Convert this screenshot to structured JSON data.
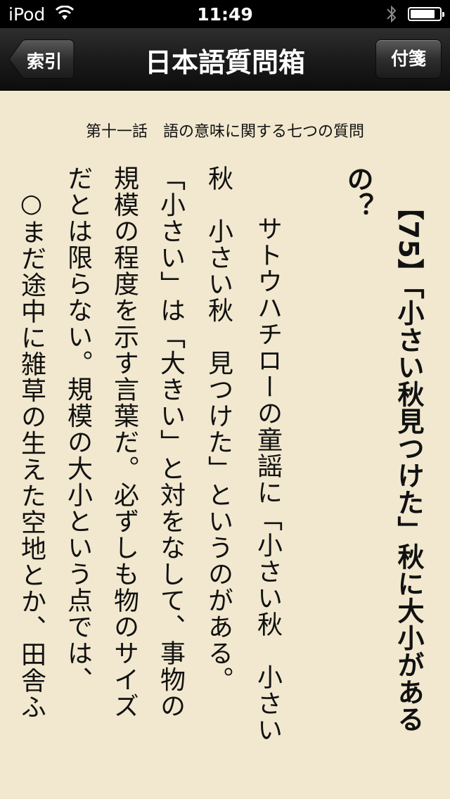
{
  "status": {
    "carrier": "iPod",
    "time": "11:49",
    "battery_level": 0.85
  },
  "nav": {
    "back_label": "索引",
    "title": "日本語質問箱",
    "tag_label": "付箋"
  },
  "chapter": {
    "heading": "第十一話　語の意味に関する七つの質問"
  },
  "article": {
    "title_col1": "【75】「小さい秋見つけた」秋に大小がある",
    "title_col2": "の？",
    "body": [
      "　サトウハチローの童謡に「小さい秋　小さい",
      "秋　小さい秋　見つけた」というのがある。",
      "「小さい」は「大きい」と対をなして、事物の",
      "規模の程度を示す言葉だ。必ずしも物のサイズ",
      "だとは限らない。規模の大小という点では、",
      "○まだ途中に雑草の生えた空地とか、田舎ふ"
    ]
  }
}
